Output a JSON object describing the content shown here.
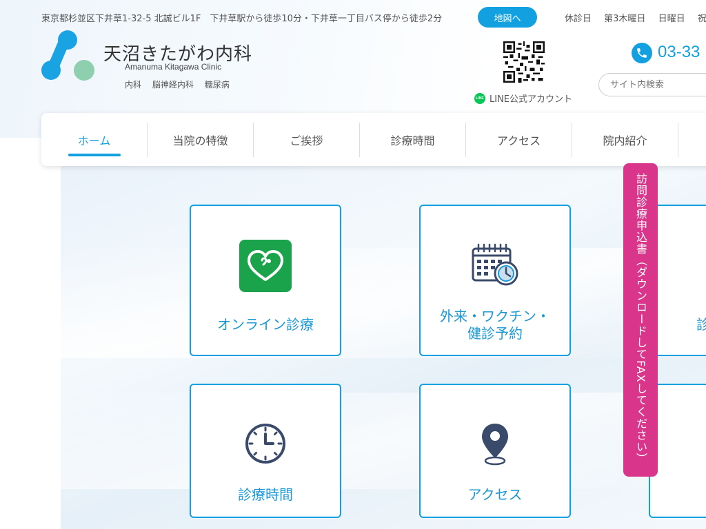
{
  "header": {
    "address": "東京都杉並区下井草1-32-5 北誠ビル1F　下井草駅から徒歩10分・下井草一丁目バス停から徒歩2分",
    "map_button": "地図へ",
    "closed_days": [
      "休診日",
      "第3木曜日",
      "日曜日",
      "祝"
    ]
  },
  "logo": {
    "title": "天沼きたがわ内科",
    "subtitle": "Amanuma Kitagawa Clinic",
    "departments": [
      "内科",
      "脳神経内科",
      "糖尿病"
    ],
    "colors": {
      "blue": "#1aa3e3",
      "green": "#8ecfb0"
    }
  },
  "line": {
    "label": "LINE公式アカウント",
    "icon_text": "LINE"
  },
  "phone": {
    "number": "03-33"
  },
  "search": {
    "placeholder": "サイト内検索"
  },
  "nav": {
    "items": [
      {
        "label": "ホーム",
        "active": true
      },
      {
        "label": "当院の特徴"
      },
      {
        "label": "ご挨拶"
      },
      {
        "label": "診療時間"
      },
      {
        "label": "アクセス"
      },
      {
        "label": "院内紹介"
      }
    ]
  },
  "cards": [
    {
      "label": "オンライン診療",
      "icon": "heart-chat-icon"
    },
    {
      "label_line1": "外来・ワクチン・",
      "label_line2": "健診予約",
      "icon": "calendar-clock-icon"
    },
    {
      "label_partial": "診",
      "icon": ""
    },
    {
      "label": "診療時間",
      "icon": "clock-icon"
    },
    {
      "label": "アクセス",
      "icon": "map-pin-icon"
    }
  ],
  "side_tab": {
    "label": "訪問診療申込書（ダウンロードしてFAXしてください）"
  },
  "colors": {
    "accent": "#12a0e0",
    "pink": "#d9358a",
    "green_tile": "#1aa34a",
    "navy": "#3a4a6b"
  }
}
